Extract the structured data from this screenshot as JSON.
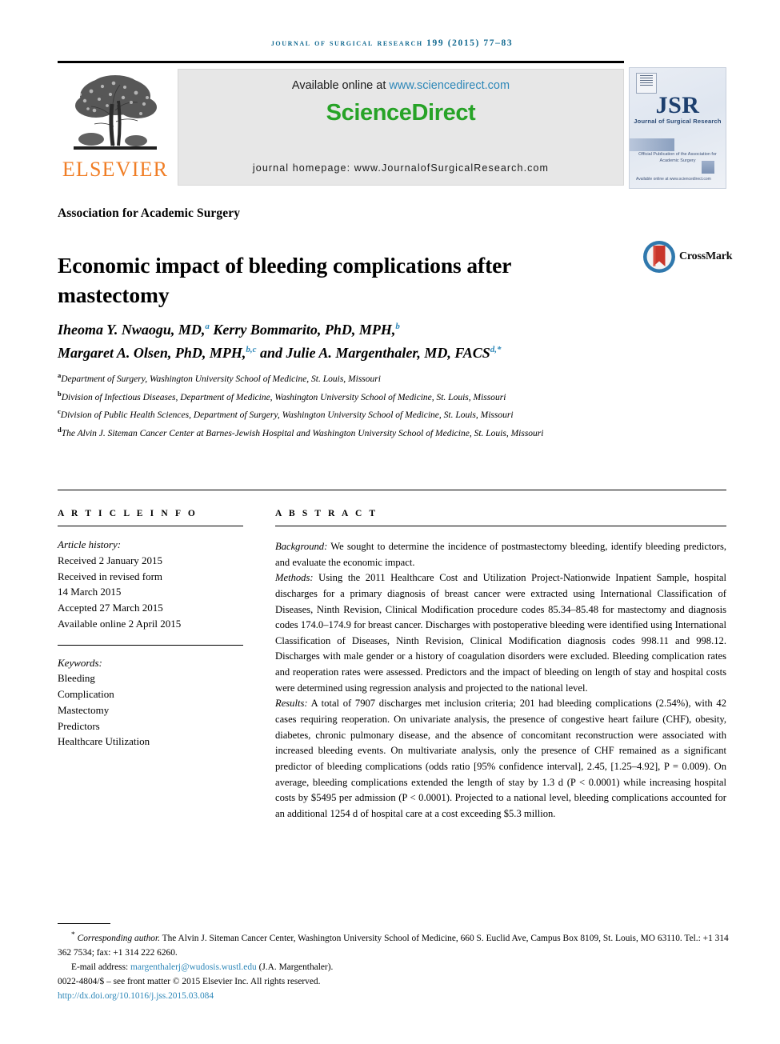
{
  "running_head": "Journal of Surgical Research 199 (2015) 77–83",
  "masthead": {
    "publisher_name": "ELSEVIER",
    "available_prefix": "Available online at ",
    "available_link": "www.sciencedirect.com",
    "sciencedirect_logo": "ScienceDirect",
    "journal_homepage": "journal homepage: www.JournalofSurgicalResearch.com",
    "cover": {
      "title": "JSR",
      "subtitle": "Journal of Surgical Research",
      "association_line": "Official Publication of the Association for Academic Surgery",
      "footer_line": "Available online at www.sciencedirect.com"
    }
  },
  "article": {
    "society": "Association for Academic Surgery",
    "title": "Economic impact of bleeding complications after mastectomy",
    "crossmark_label": "CrossMark",
    "authors_line_1_a": "Iheoma Y. Nwaogu, MD,",
    "authors_line_1_a_sup": "a",
    "authors_line_1_b": " Kerry Bommarito, PhD, MPH,",
    "authors_line_1_b_sup": "b",
    "authors_line_2_a": "Margaret A. Olsen, PhD, MPH,",
    "authors_line_2_a_sup": "b,c",
    "authors_line_2_b": " and Julie A. Margenthaler, MD, FACS",
    "authors_line_2_b_sup": "d,*",
    "affiliations": [
      {
        "marker": "a",
        "text": "Department of Surgery, Washington University School of Medicine, St. Louis, Missouri"
      },
      {
        "marker": "b",
        "text": "Division of Infectious Diseases, Department of Medicine, Washington University School of Medicine, St. Louis, Missouri"
      },
      {
        "marker": "c",
        "text": "Division of Public Health Sciences, Department of Surgery, Washington University School of Medicine, St. Louis, Missouri"
      },
      {
        "marker": "d",
        "text": "The Alvin J. Siteman Cancer Center at Barnes-Jewish Hospital and Washington University School of Medicine, St. Louis, Missouri"
      }
    ]
  },
  "article_info": {
    "heading": "A R T I C L E  I N F O",
    "history_label": "Article history:",
    "history": [
      "Received 2 January 2015",
      "Received in revised form",
      "14 March 2015",
      "Accepted 27 March 2015",
      "Available online 2 April 2015"
    ],
    "keywords_label": "Keywords:",
    "keywords": [
      "Bleeding",
      "Complication",
      "Mastectomy",
      "Predictors",
      "Healthcare Utilization"
    ]
  },
  "abstract": {
    "heading": "A B S T R A C T",
    "sections": [
      {
        "label": "Background:",
        "text": " We sought to determine the incidence of postmastectomy bleeding, identify bleeding predictors, and evaluate the economic impact."
      },
      {
        "label": "Methods:",
        "text": " Using the 2011 Healthcare Cost and Utilization Project-Nationwide Inpatient Sample, hospital discharges for a primary diagnosis of breast cancer were extracted using International Classification of Diseases, Ninth Revision, Clinical Modification procedure codes 85.34–85.48 for mastectomy and diagnosis codes 174.0–174.9 for breast cancer. Discharges with postoperative bleeding were identified using International Classification of Diseases, Ninth Revision, Clinical Modification diagnosis codes 998.11 and 998.12. Discharges with male gender or a history of coagulation disorders were excluded. Bleeding complication rates and reoperation rates were assessed. Predictors and the impact of bleeding on length of stay and hospital costs were determined using regression analysis and projected to the national level."
      },
      {
        "label": "Results:",
        "text": " A total of 7907 discharges met inclusion criteria; 201 had bleeding complications (2.54%), with 42 cases requiring reoperation. On univariate analysis, the presence of congestive heart failure (CHF), obesity, diabetes, chronic pulmonary disease, and the absence of concomitant reconstruction were associated with increased bleeding events. On multivariate analysis, only the presence of CHF remained as a significant predictor of bleeding complications (odds ratio [95% confidence interval], 2.45, [1.25–4.92], P = 0.009). On average, bleeding complications extended the length of stay by 1.3 d (P < 0.0001) while increasing hospital costs by $5495 per admission (P < 0.0001). Projected to a national level, bleeding complications accounted for an additional 1254 d of hospital care at a cost exceeding $5.3 million."
      }
    ]
  },
  "footer": {
    "corresponding_marker": "*",
    "corresponding_label": "Corresponding author.",
    "corresponding_address": " The Alvin J. Siteman Cancer Center, Washington University School of Medicine, 660 S. Euclid Ave, Campus Box 8109, St. Louis, MO 63110. Tel.: +1 314 362 7534; fax: +1 314 222 6260.",
    "email_label": "E-mail address: ",
    "email": "margenthalerj@wudosis.wustl.edu",
    "email_suffix": " (J.A. Margenthaler).",
    "copyright": "0022-4804/$ – see front matter © 2015 Elsevier Inc. All rights reserved.",
    "doi": "http://dx.doi.org/10.1016/j.jss.2015.03.084"
  },
  "colors": {
    "link_blue": "#2d87b8",
    "runhead_blue": "#136a91",
    "elsevier_orange": "#f07e26",
    "sciencedirect_green": "#27a327",
    "crossmark_blue": "#2f78ad",
    "crossmark_red": "#c8352a"
  }
}
